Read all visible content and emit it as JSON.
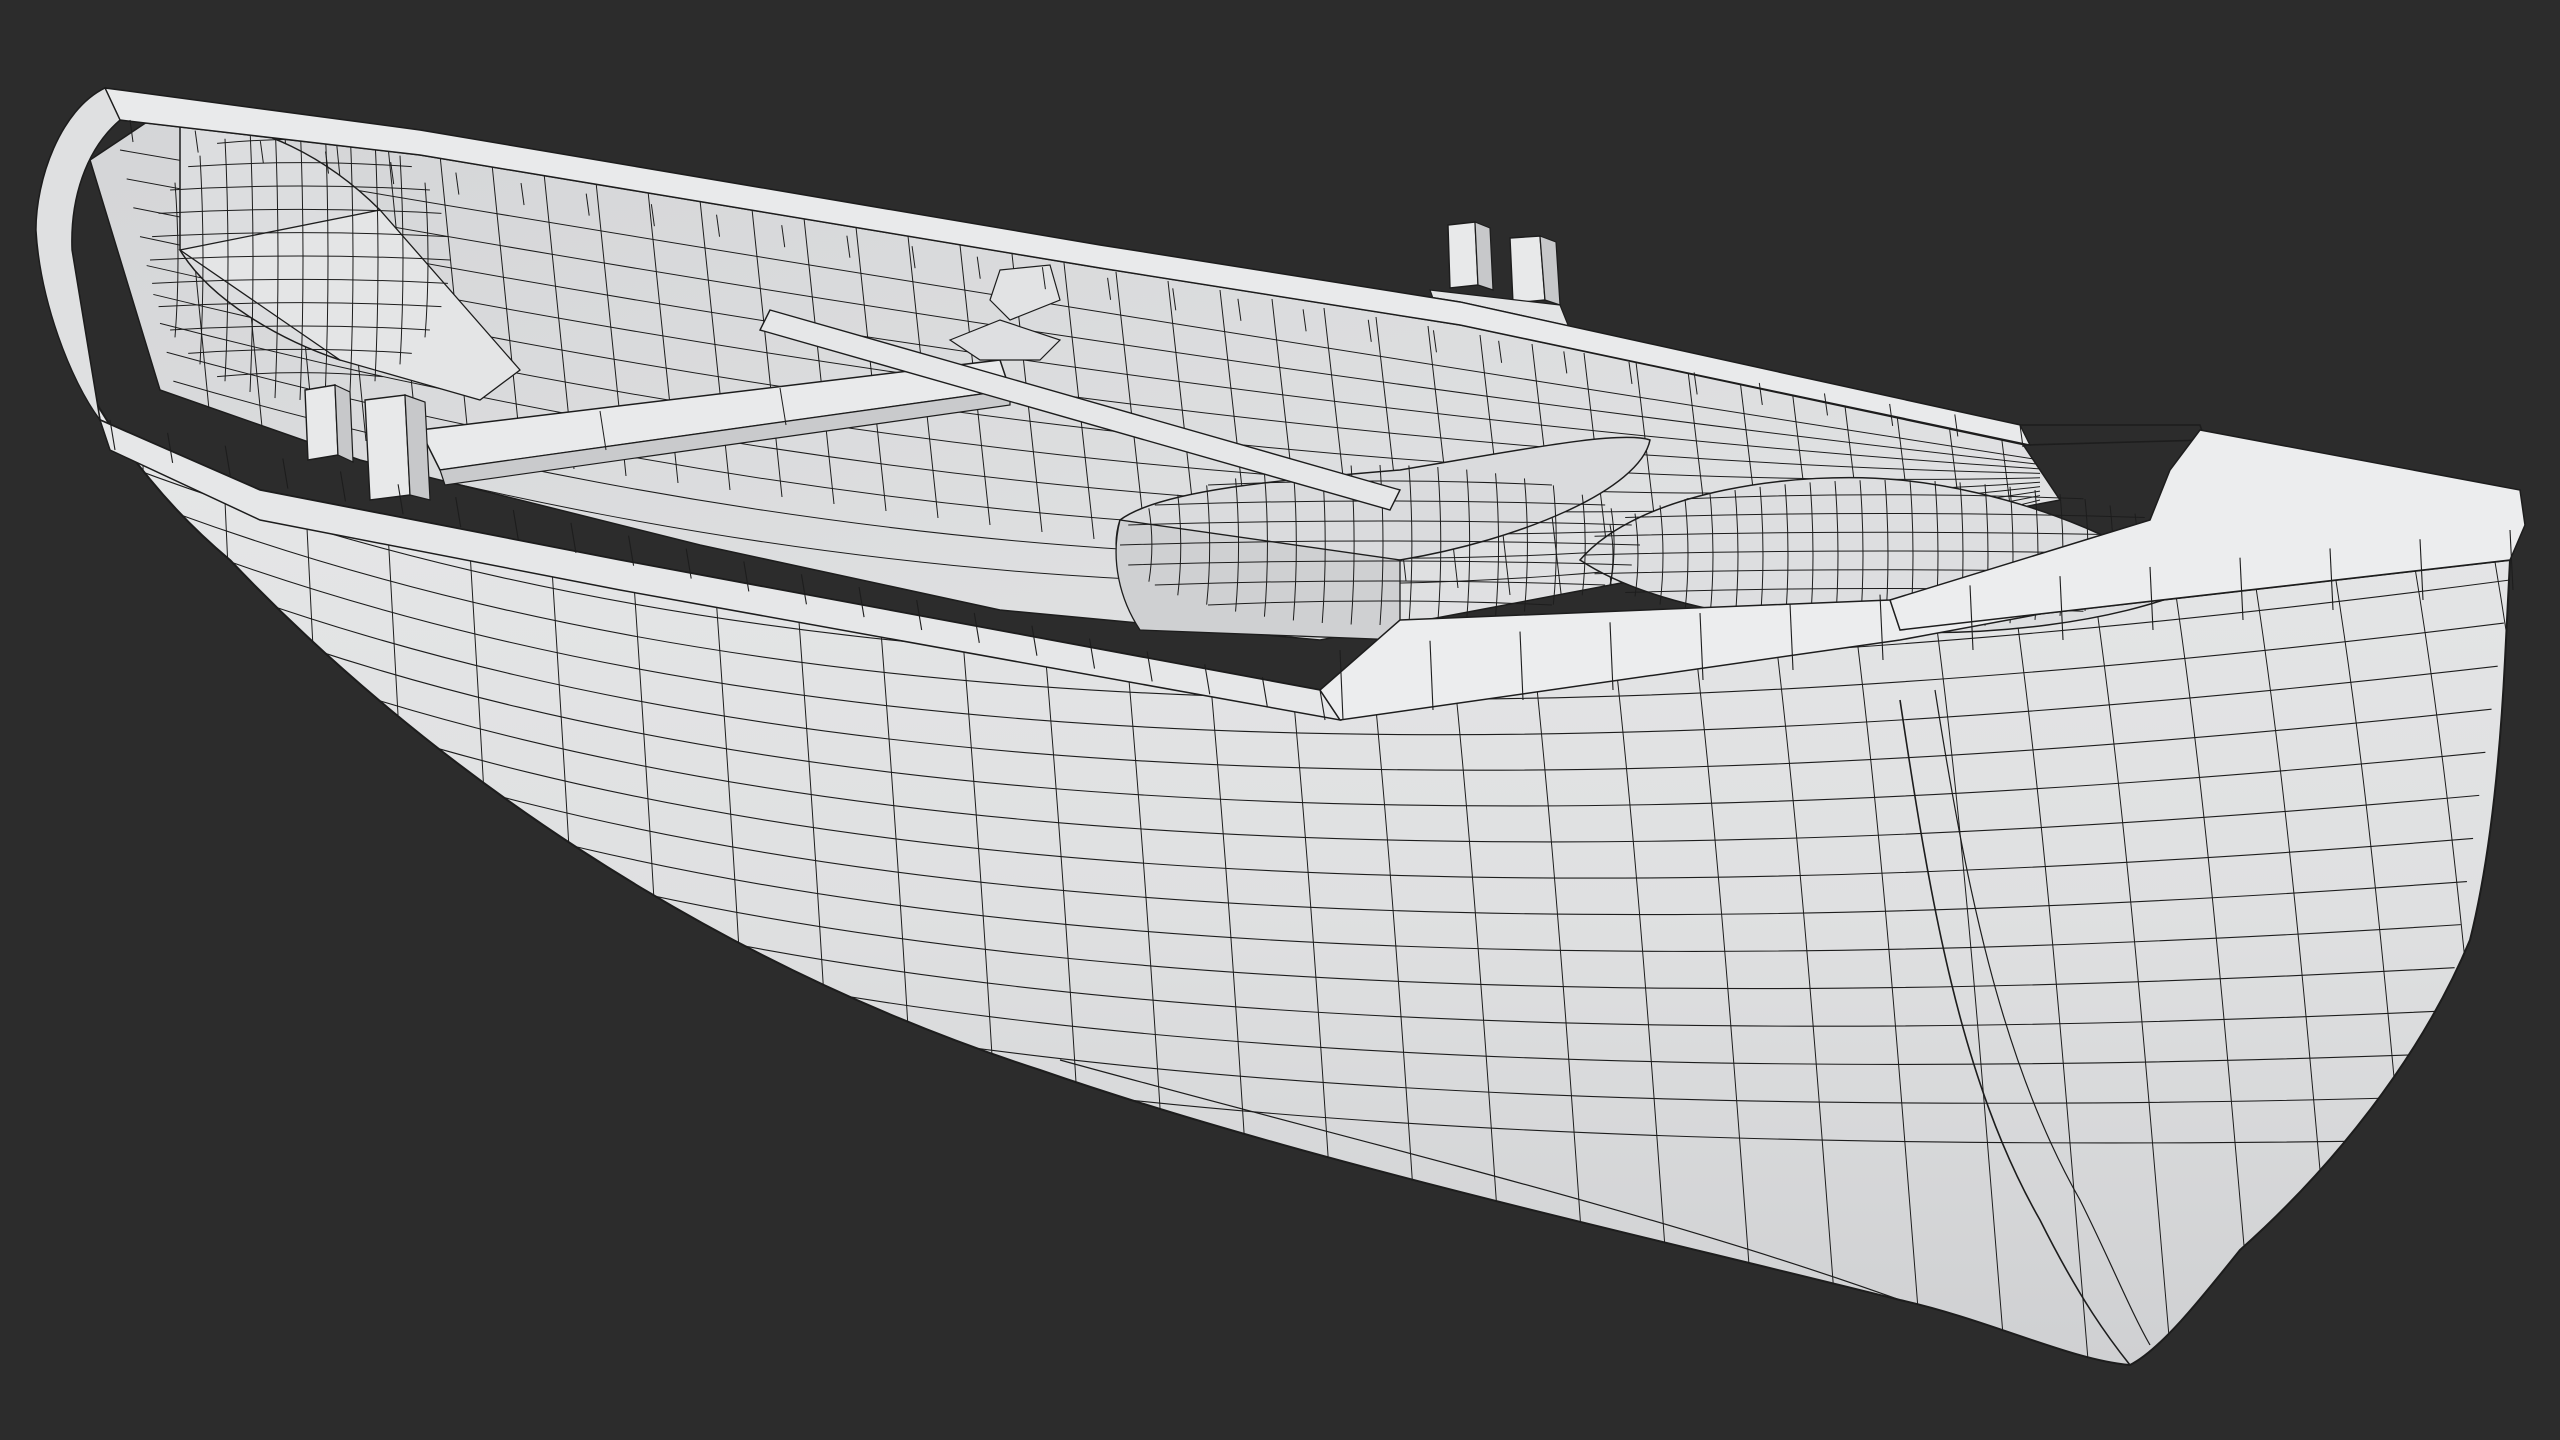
{
  "viewport": {
    "background_color": "#2c2c2c",
    "model": {
      "subject": "rowing-boat",
      "shading": "clay-wireframe-overlay",
      "surface_color": "#e3e4e5",
      "shadow_color": "#b9bbbd",
      "highlight_color": "#f1f2f3",
      "wire_color": "#1d1d1d"
    }
  }
}
